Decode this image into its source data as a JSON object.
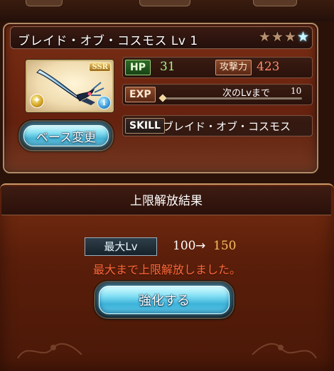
{
  "weapon": {
    "name": "ブレイド・オブ・コスモス Lv 1",
    "stars": [
      {
        "name": "rank-star-1",
        "lit": false
      },
      {
        "name": "rank-star-2",
        "lit": false
      },
      {
        "name": "rank-star-3",
        "lit": false
      },
      {
        "name": "rank-star-4",
        "lit": true
      }
    ],
    "rarity": "SSR",
    "info_glyph": "i",
    "base_change_label": "ベース変更"
  },
  "stats": {
    "hp_label": "HP",
    "hp_value": "31",
    "atk_label": "攻撃力",
    "atk_value": "423",
    "exp_label": "EXP",
    "exp_next_label": "次のLvまで",
    "exp_next_value": "10",
    "exp_progress": 0.0,
    "skill_label": "SKILL",
    "skill_name": "ブレイド・オブ・コスモス"
  },
  "result": {
    "title": "上限解放結果",
    "max_lv_label": "最大Lv",
    "lv_from": "100",
    "arrow": "→",
    "lv_to": "150",
    "message": "最大まで上限解放しました。",
    "enhance_label": "強化する"
  },
  "colors": {
    "hp_value": "#a8f08a",
    "atk_value": "#ff8a6a",
    "lv_to": "#f4c060",
    "message": "#ff6a3a",
    "button_glow": "#5ecaea"
  },
  "icons": {
    "element": "light-element-icon",
    "info": "info-icon",
    "weapon_art": "sword-image"
  }
}
